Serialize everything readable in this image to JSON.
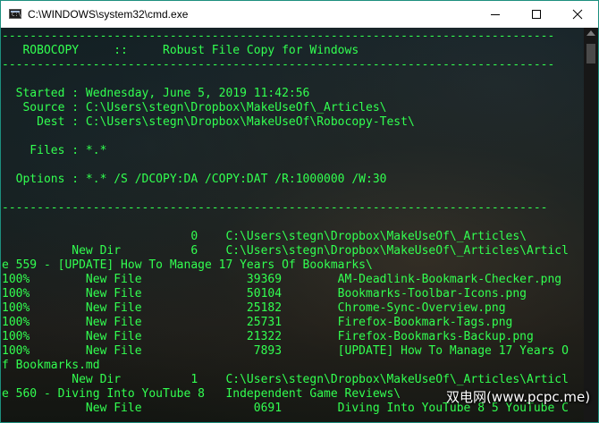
{
  "window": {
    "title": "C:\\WINDOWS\\system32\\cmd.exe",
    "icon": "cmd-app-icon",
    "controls": [
      "minimize-icon",
      "maximize-icon",
      "close-icon"
    ]
  },
  "console": {
    "text_color": "#32ff50",
    "lines": [
      "-------------------------------------------------------------------------------",
      "   ROBOCOPY     ::     Robust File Copy for Windows",
      "-------------------------------------------------------------------------------",
      "",
      "  Started : Wednesday, June 5, 2019 11:42:56",
      "   Source : C:\\Users\\stegn\\Dropbox\\MakeUseOf\\_Articles\\",
      "     Dest : C:\\Users\\stegn\\Dropbox\\MakeUseOf\\Robocopy-Test\\",
      "",
      "    Files : *.*",
      "",
      "  Options : *.* /S /DCOPY:DA /COPY:DAT /R:1000000 /W:30",
      "",
      "------------------------------------------------------------------------------",
      "",
      "                           0    C:\\Users\\stegn\\Dropbox\\MakeUseOf\\_Articles\\",
      "          New Dir          6    C:\\Users\\stegn\\Dropbox\\MakeUseOf\\_Articles\\Articl",
      "e 559 - [UPDATE] How To Manage 17 Years Of Bookmarks\\",
      "100%        New File               39369        AM-Deadlink-Bookmark-Checker.png",
      "100%        New File               50104        Bookmarks-Toolbar-Icons.png",
      "100%        New File               25182        Chrome-Sync-Overview.png",
      "100%        New File               25731        Firefox-Bookmark-Tags.png",
      "100%        New File               21322        Firefox-Bookmarks-Backup.png",
      "100%        New File                7893        [UPDATE] How To Manage 17 Years O",
      "f Bookmarks.md",
      "          New Dir          1    C:\\Users\\stegn\\Dropbox\\MakeUseOf\\_Articles\\Articl",
      "e 560 - Diving Into YouTube 8   Independent Game Reviews\\",
      "            New File                0691        Diving Into YouTube 8 5 YouTube C"
    ]
  },
  "watermark": "双电网(www.pcpc.me)"
}
